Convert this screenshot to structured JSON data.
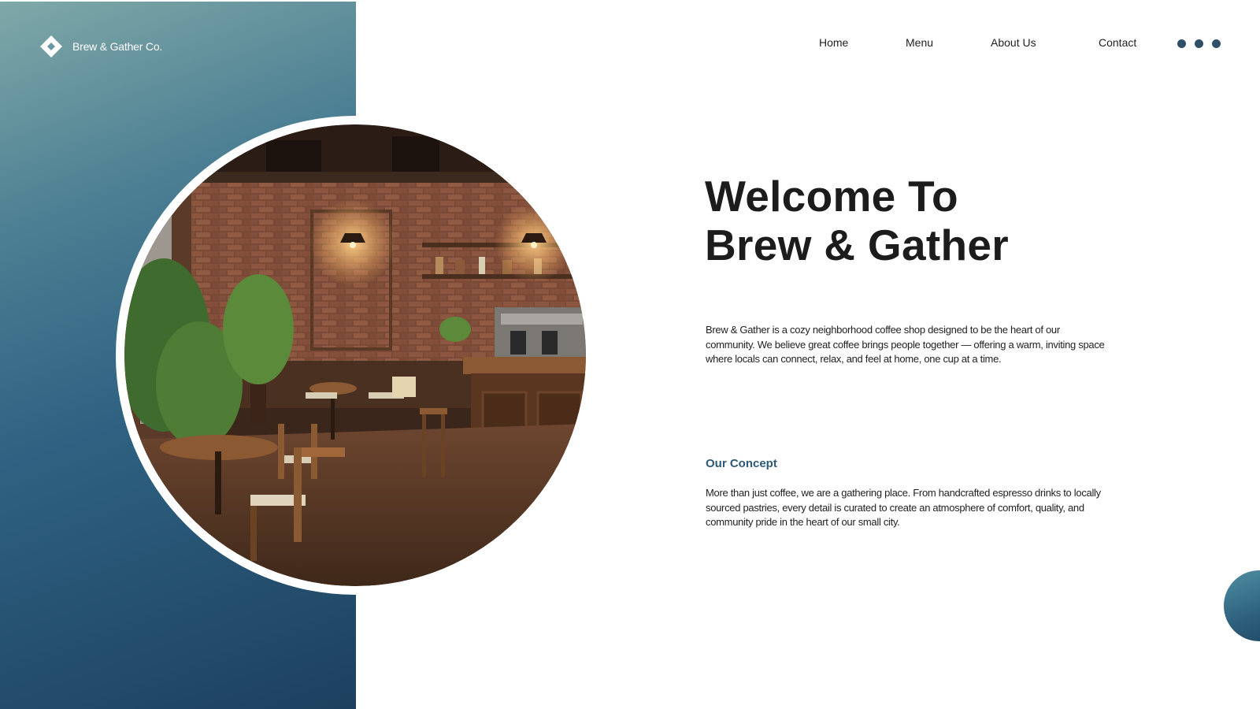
{
  "brand": {
    "name": "Brew & Gather Co.",
    "logo_icon": "diamond-logo-icon"
  },
  "nav": {
    "items": [
      {
        "label": "Home"
      },
      {
        "label": "Menu"
      },
      {
        "label": "About Us"
      },
      {
        "label": "Contact"
      }
    ],
    "more_icon": "more-dots-icon"
  },
  "hero": {
    "title_line1": "Welcome To",
    "title_line2": "Brew & Gather",
    "intro": "Brew & Gather is a cozy neighborhood coffee shop designed to be the heart of our community. We believe great coffee brings people together — offering a warm, inviting space where locals can connect, relax, and feel at home, one cup at a time.",
    "image_alt": "Cozy café interior with brick walls, wooden tables and chairs, plants and an espresso bar"
  },
  "concept": {
    "heading": "Our Concept",
    "text": "More than just coffee, we are a gathering place. From handcrafted espresso drinks to locally sourced pastries, every detail is curated to create an atmosphere of comfort, quality, and community pride in the heart of our small city."
  },
  "colors": {
    "panel_light": "#7fa8a8",
    "panel_dark": "#1d405f",
    "accent": "#2c5a78",
    "dots": "#2e4f66"
  }
}
